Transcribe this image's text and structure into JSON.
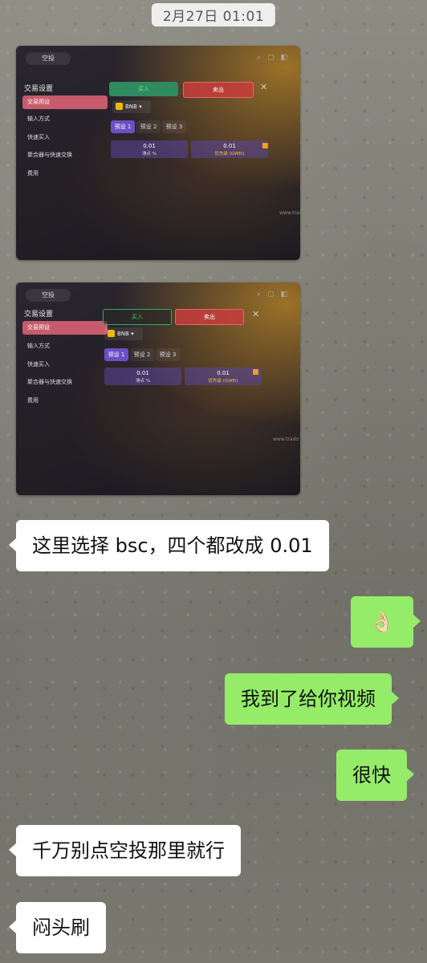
{
  "timestamp": "2月27日 01:01",
  "screenshot": {
    "tab_label": "空投",
    "settings_title": "交易设置",
    "sidebar_items": [
      "交易预设",
      "输入方式",
      "快速买入",
      "聚合器与快速交换",
      "费用"
    ],
    "buy_label": "买入",
    "sell_label": "卖出",
    "close_symbol": "✕",
    "chain": "BNB",
    "presets": [
      "预设 1",
      "预设 2",
      "预设 3"
    ],
    "slippage_value": "0.01",
    "slippage_label": "滑点 %",
    "priority_value": "0.01",
    "priority_label": "优先级 (GWEI)",
    "url_fragment": "www.trado"
  },
  "messages": [
    {
      "side": "left",
      "text": "这里选择 bsc，四个都改成 0.01"
    },
    {
      "side": "right",
      "text": "👌🏻"
    },
    {
      "side": "right",
      "text": "我到了给你视频"
    },
    {
      "side": "right",
      "text": "很快"
    },
    {
      "side": "left",
      "text": "千万别点空投那里就行"
    },
    {
      "side": "left",
      "text": "闷头刷"
    }
  ],
  "colors": {
    "left_bubble": "#ffffff",
    "right_bubble": "#95ec69",
    "active_preset": "#6b4fc3",
    "active_sidebar": "#c75b6c"
  }
}
